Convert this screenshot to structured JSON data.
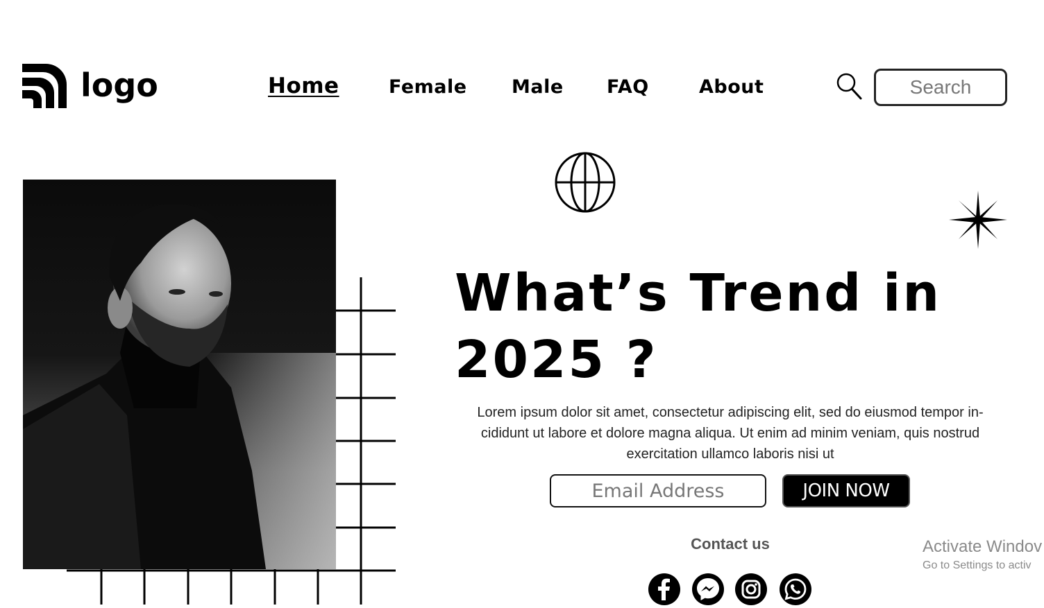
{
  "header": {
    "logo_text": "logo",
    "nav": [
      {
        "label": "Home",
        "active": true
      },
      {
        "label": "Female"
      },
      {
        "label": "Male"
      },
      {
        "label": "FAQ"
      },
      {
        "label": "About"
      }
    ],
    "search_placeholder": "Search",
    "search_icon": "magnifier-icon"
  },
  "hero": {
    "headline_line1": "What’s Trend in",
    "headline_line2": "2025 ?",
    "body": "Lorem ipsum dolor sit amet, consectetur adipiscing elit, sed do eiusmod tempor in- cididunt ut labore et dolore magna aliqua. Ut enim ad minim veniam, quis nostrud exercitation ullamco laboris nisi ut",
    "email_placeholder": "Email Address",
    "join_label": "JOIN NOW"
  },
  "contact": {
    "label": "Contact us",
    "icons": [
      "facebook-icon",
      "messenger-icon",
      "instagram-icon",
      "whatsapp-icon"
    ]
  },
  "windows_watermark": {
    "line1": "Activate Windov",
    "line2": "Go to Settings to activ"
  },
  "colors": {
    "primary": "#000000",
    "background": "#ffffff",
    "muted": "#777777"
  }
}
